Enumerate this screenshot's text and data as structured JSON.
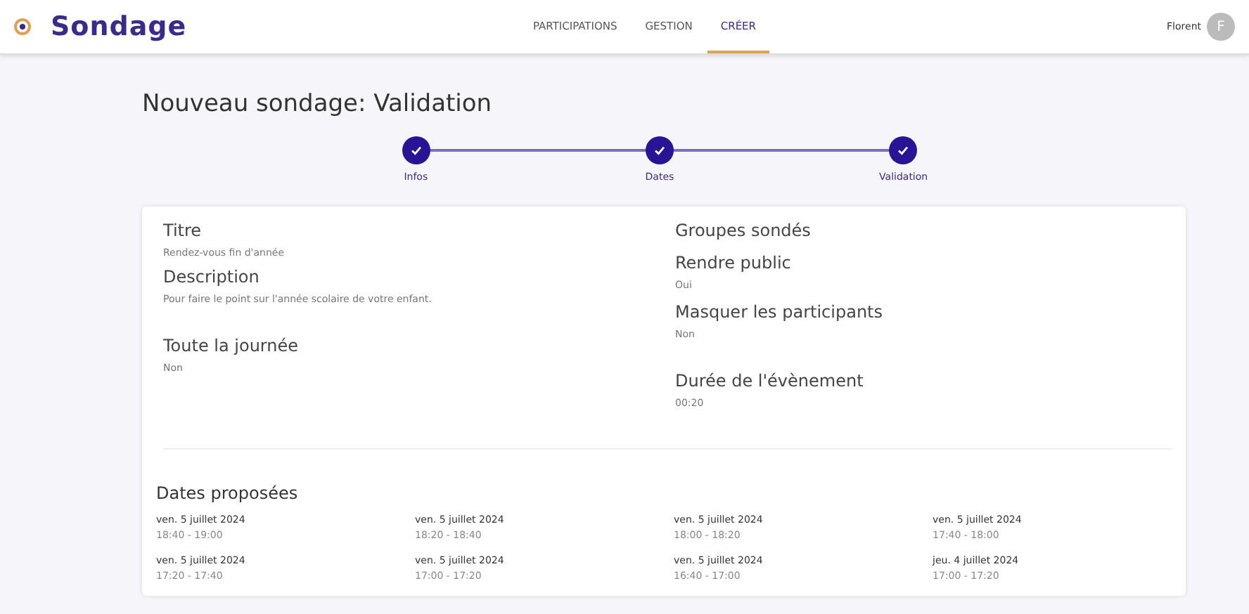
{
  "header": {
    "logo": "Sondage",
    "nav": [
      {
        "label": "PARTICIPATIONS",
        "selected": false
      },
      {
        "label": "GESTION",
        "selected": false
      },
      {
        "label": "CRÉER",
        "selected": true
      }
    ],
    "user": {
      "name": "Florent",
      "initial": "F"
    }
  },
  "page_title": "Nouveau sondage: Validation",
  "steps": [
    {
      "label": "Infos",
      "done": true
    },
    {
      "label": "Dates",
      "done": true
    },
    {
      "label": "Validation",
      "done": true
    }
  ],
  "summary": {
    "left": [
      {
        "label": "Titre",
        "value": "Rendez-vous fin d'année"
      },
      {
        "label": "Description",
        "value": "Pour faire le point sur l'année scolaire de votre enfant."
      },
      {
        "label": "Toute la journée",
        "value": "Non"
      }
    ],
    "right": [
      {
        "label": "Groupes sondés"
      },
      {
        "label": "Rendre public",
        "value": "Oui"
      },
      {
        "label": "Masquer les participants",
        "value": "Non"
      },
      {
        "label": "Durée de l'évènement",
        "value": "00:20"
      }
    ]
  },
  "dates": {
    "title": "Dates proposées",
    "items": [
      {
        "date": "ven. 5 juillet 2024",
        "time": "18:40 - 19:00"
      },
      {
        "date": "ven. 5 juillet 2024",
        "time": "18:20 - 18:40"
      },
      {
        "date": "ven. 5 juillet 2024",
        "time": "18:00 - 18:20"
      },
      {
        "date": "ven. 5 juillet 2024",
        "time": "17:40 - 18:00"
      },
      {
        "date": "ven. 5 juillet 2024",
        "time": "17:20 - 17:40"
      },
      {
        "date": "ven. 5 juillet 2024",
        "time": "17:00 - 17:20"
      },
      {
        "date": "ven. 5 juillet 2024",
        "time": "16:40 - 17:00"
      },
      {
        "date": "jeu. 4 juillet 2024",
        "time": "17:00 - 17:20"
      }
    ]
  }
}
